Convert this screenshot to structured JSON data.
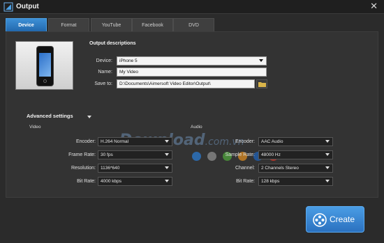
{
  "window": {
    "title": "Output",
    "close_glyph": "✕"
  },
  "tabs": [
    {
      "label": "Device",
      "active": true
    },
    {
      "label": "Format",
      "active": false
    },
    {
      "label": "YouTube",
      "active": false
    },
    {
      "label": "Facebook",
      "active": false
    },
    {
      "label": "DVD",
      "active": false
    }
  ],
  "output": {
    "title": "Output descriptions",
    "device_label": "Device:",
    "device_value": "iPhone 5",
    "name_label": "Name:",
    "name_value": "My Video",
    "saveto_label": "Save to:",
    "saveto_value": "D:\\Documents\\Aimersoft Video Editor\\Output\\"
  },
  "advanced": {
    "title": "Advanced settings",
    "video_label": "Video",
    "audio_label": "Audio"
  },
  "video": [
    {
      "label": "Encoder:",
      "value": "H.264 Normal"
    },
    {
      "label": "Frame Rate:",
      "value": "30 fps"
    },
    {
      "label": "Resolution:",
      "value": "1136*640"
    },
    {
      "label": "Bit Rate:",
      "value": "4000 kbps"
    }
  ],
  "audio": [
    {
      "label": "Encoder:",
      "value": "AAC Audio"
    },
    {
      "label": "Sample Rate:",
      "value": "48000 Hz"
    },
    {
      "label": "Channel:",
      "value": "2 Channels Stereo"
    },
    {
      "label": "Bit Rate:",
      "value": "128 kbps"
    }
  ],
  "watermark": {
    "main": "Download",
    "suffix": ".com.vn"
  },
  "watermark_dot_colors": [
    "#2b7bd0",
    "#8d8d8d",
    "#4fa33c",
    "#d98a1f",
    "#1f62b5",
    "#d23a2a"
  ],
  "create_button": {
    "label": "Create"
  },
  "colors": {
    "accent": "#2f7fcf",
    "background": "#2b2b2b"
  }
}
